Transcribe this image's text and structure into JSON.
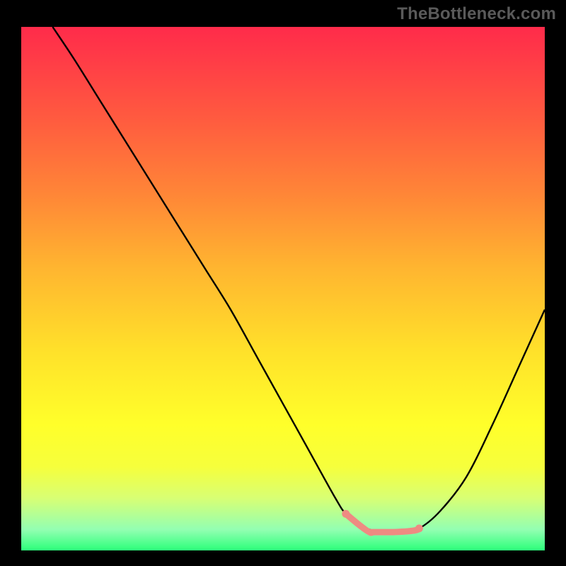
{
  "watermark": "TheBottleneck.com",
  "colors": {
    "curve": "#000000",
    "marker": "#ee8b82",
    "gradient_top": "#ff2b4a",
    "gradient_bottom": "#2cff7a",
    "frame_bg": "#000000"
  },
  "chart_data": {
    "type": "line",
    "title": "",
    "xlabel": "",
    "ylabel": "",
    "xlim": [
      0,
      100
    ],
    "ylim": [
      0,
      100
    ],
    "grid": false,
    "legend": false,
    "x": [
      6,
      10,
      15,
      20,
      25,
      30,
      35,
      40,
      45,
      50,
      55,
      60,
      62,
      65,
      68,
      70,
      73,
      76,
      80,
      85,
      90,
      95,
      100
    ],
    "y": [
      100,
      94,
      86,
      78,
      70,
      62,
      54,
      46,
      37,
      28,
      19,
      10,
      7,
      4.6,
      3.6,
      3.5,
      3.6,
      4.2,
      7.5,
      14,
      24,
      35,
      46
    ],
    "optimal_range": {
      "x_start": 62,
      "x_end": 76,
      "y_start": 7.0,
      "y_mid": 3.5,
      "y_end": 4.2
    }
  }
}
